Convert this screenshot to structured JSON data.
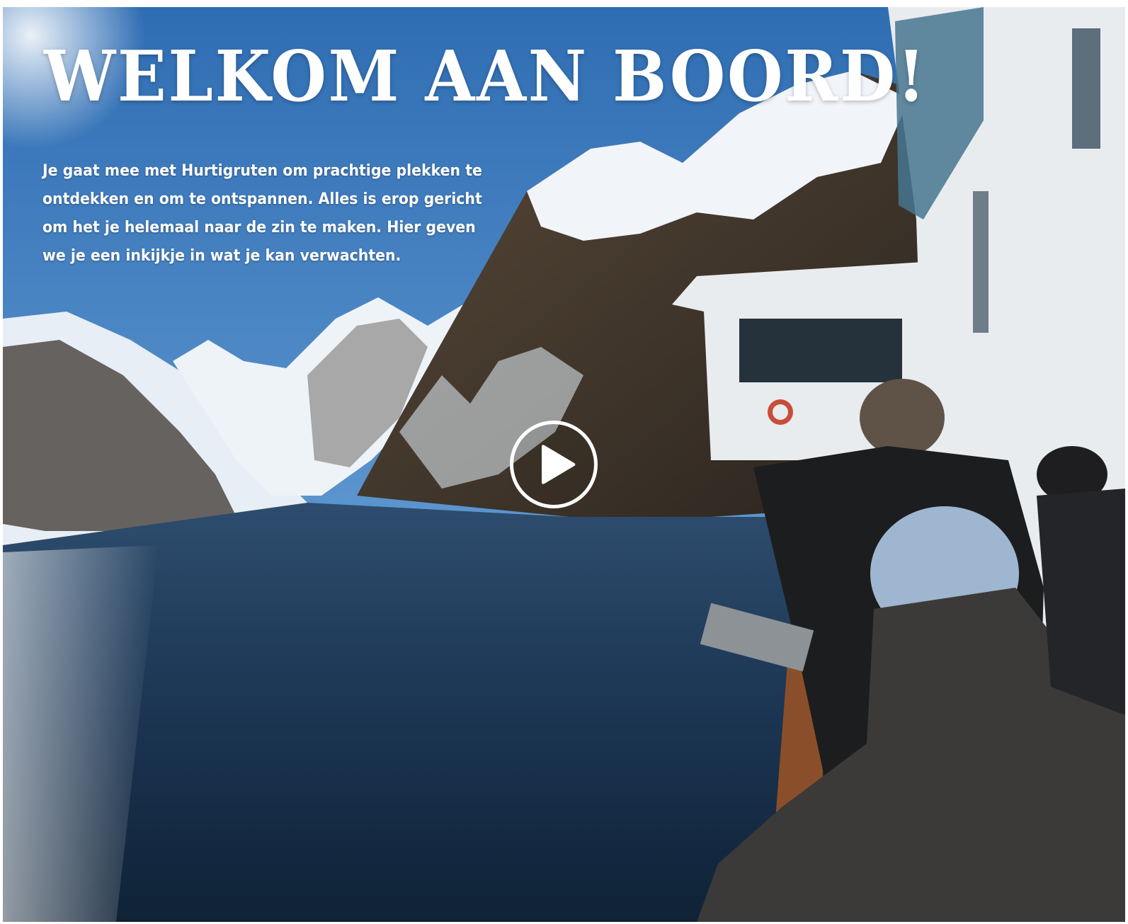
{
  "hero": {
    "title": "WELKOM AAN BOORD!",
    "intro": "Je gaat mee met Hurtigruten om prachtige plekken te ontdekken en om te ontspannen. Alles is erop gericht om het je helemaal naar de zin te maken. Hier geven we je een inkijkje in wat je kan verwachten.",
    "play_icon": "play-icon"
  },
  "colors": {
    "title_text": "#ffffff",
    "sky": "#3f7fc4",
    "water": "#1b3552"
  }
}
